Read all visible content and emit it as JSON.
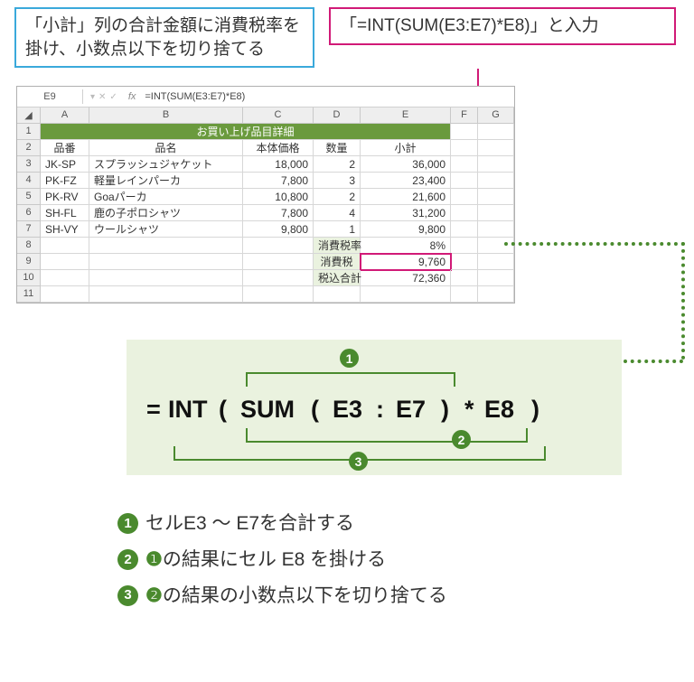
{
  "callouts": {
    "blue": "「小計」列の合計金額に消費税率を掛け、小数点以下を切り捨てる",
    "pink": "「=INT(SUM(E3:E7)*E8)」と入力"
  },
  "formula_bar": {
    "cell_ref": "E9",
    "fx_glyph": "fx",
    "formula": "=INT(SUM(E3:E7)*E8)"
  },
  "sheet": {
    "cols": [
      "A",
      "B",
      "C",
      "D",
      "E",
      "F",
      "G"
    ],
    "title_row": "お買い上げ品目詳細",
    "headers": {
      "a": "品番",
      "b": "品名",
      "c": "本体価格",
      "d": "数量",
      "e": "小計"
    },
    "rows": [
      {
        "no": "3",
        "a": "JK-SP",
        "b": "スプラッシュジャケット",
        "c": "18,000",
        "d": "2",
        "e": "36,000"
      },
      {
        "no": "4",
        "a": "PK-FZ",
        "b": "軽量レインパーカ",
        "c": "7,800",
        "d": "3",
        "e": "23,400"
      },
      {
        "no": "5",
        "a": "PK-RV",
        "b": "Goaパーカ",
        "c": "10,800",
        "d": "2",
        "e": "21,600"
      },
      {
        "no": "6",
        "a": "SH-FL",
        "b": "鹿の子ポロシャツ",
        "c": "7,800",
        "d": "4",
        "e": "31,200"
      },
      {
        "no": "7",
        "a": "SH-VY",
        "b": "ウールシャツ",
        "c": "9,800",
        "d": "1",
        "e": "9,800"
      }
    ],
    "totals": {
      "tax_rate_label": "消費税率",
      "tax_rate_value": "8%",
      "tax_label": "消費税",
      "tax_value": "9,760",
      "grand_label": "税込合計",
      "grand_value": "72,360"
    }
  },
  "formula_display": {
    "eq": "=",
    "int": "INT",
    "lp1": "(",
    "sum": "SUM",
    "lp2": "(",
    "r1": "E3",
    "colon": ":",
    "r2": "E7",
    "rp2": ")",
    "star": "*",
    "r3": "E8",
    "rp1": ")"
  },
  "markers": {
    "m1": "1",
    "m2": "2",
    "m3": "3"
  },
  "legend": {
    "l1": "セルE3 ～ E7を合計する",
    "l2a": "の結果にセル E8 を掛ける",
    "l3a": "の結果の小数点以下を切り捨てる"
  }
}
